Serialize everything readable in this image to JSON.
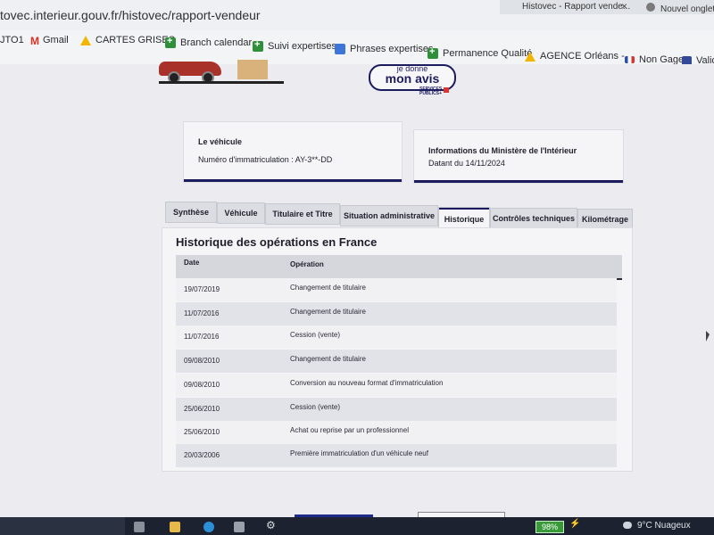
{
  "browser": {
    "url": "tovec.interieur.gouv.fr/histovec/rapport-vendeur",
    "tabs": [
      {
        "label": "Histovec - Rapport vende...",
        "close": "×"
      },
      {
        "label": "Nouvel onglet"
      }
    ]
  },
  "bookmarks": [
    {
      "label": "JTO1",
      "icon": "none"
    },
    {
      "label": "Gmail",
      "icon": "gmail-icon"
    },
    {
      "label": "CARTES GRISES",
      "icon": "drive-icon"
    },
    {
      "label": "Branch calendar",
      "icon": "sheets-icon"
    },
    {
      "label": "Suivi expertises",
      "icon": "sheets-icon"
    },
    {
      "label": "Phrases expertises",
      "icon": "docs-icon"
    },
    {
      "label": "Permanence Qualité",
      "icon": "sheets-icon"
    },
    {
      "label": "AGENCE Orléans -...",
      "icon": "drive-icon"
    },
    {
      "label": "Non Gage",
      "icon": "flag-icon"
    },
    {
      "label": "Valida",
      "icon": "square-icon"
    }
  ],
  "header": {
    "avis_small": "je donne",
    "avis_main": "mon avis",
    "services": "SERVICES PUBLICS+"
  },
  "cards": {
    "vehicle": {
      "title": "Le véhicule",
      "value": "Numéro d'immatriculation : AY-3**-DD"
    },
    "ministere": {
      "title": "Informations du Ministère de l'Intérieur",
      "value": "Datant du 14/11/2024"
    }
  },
  "tabs": [
    {
      "label": "Synthèse"
    },
    {
      "label": "Véhicule"
    },
    {
      "label": "Titulaire et Titre"
    },
    {
      "label": "Situation administrative"
    },
    {
      "label": "Historique"
    },
    {
      "label": "Contrôles techniques"
    },
    {
      "label": "Kilométrage"
    }
  ],
  "active_tab": "Historique",
  "history": {
    "title": "Historique des opérations en France",
    "columns": [
      "Date",
      "Opération"
    ],
    "rows": [
      {
        "date": "19/07/2019",
        "operation": "Changement de titulaire"
      },
      {
        "date": "11/07/2016",
        "operation": "Changement de titulaire"
      },
      {
        "date": "11/07/2016",
        "operation": "Cession (vente)"
      },
      {
        "date": "09/08/2010",
        "operation": "Changement de titulaire"
      },
      {
        "date": "09/08/2010",
        "operation": "Conversion au nouveau format d'immatriculation"
      },
      {
        "date": "25/06/2010",
        "operation": "Cession (vente)"
      },
      {
        "date": "25/06/2010",
        "operation": "Achat ou reprise par un professionnel"
      },
      {
        "date": "20/03/2006",
        "operation": "Première immatriculation d'un véhicule neuf"
      }
    ]
  },
  "taskbar": {
    "battery": "98%",
    "weather": "9°C  Nuageux",
    "icons": [
      "snap-icon",
      "files-icon",
      "skype-icon",
      "document-icon",
      "settings-icon",
      "plug-icon",
      "weather-icon"
    ]
  }
}
